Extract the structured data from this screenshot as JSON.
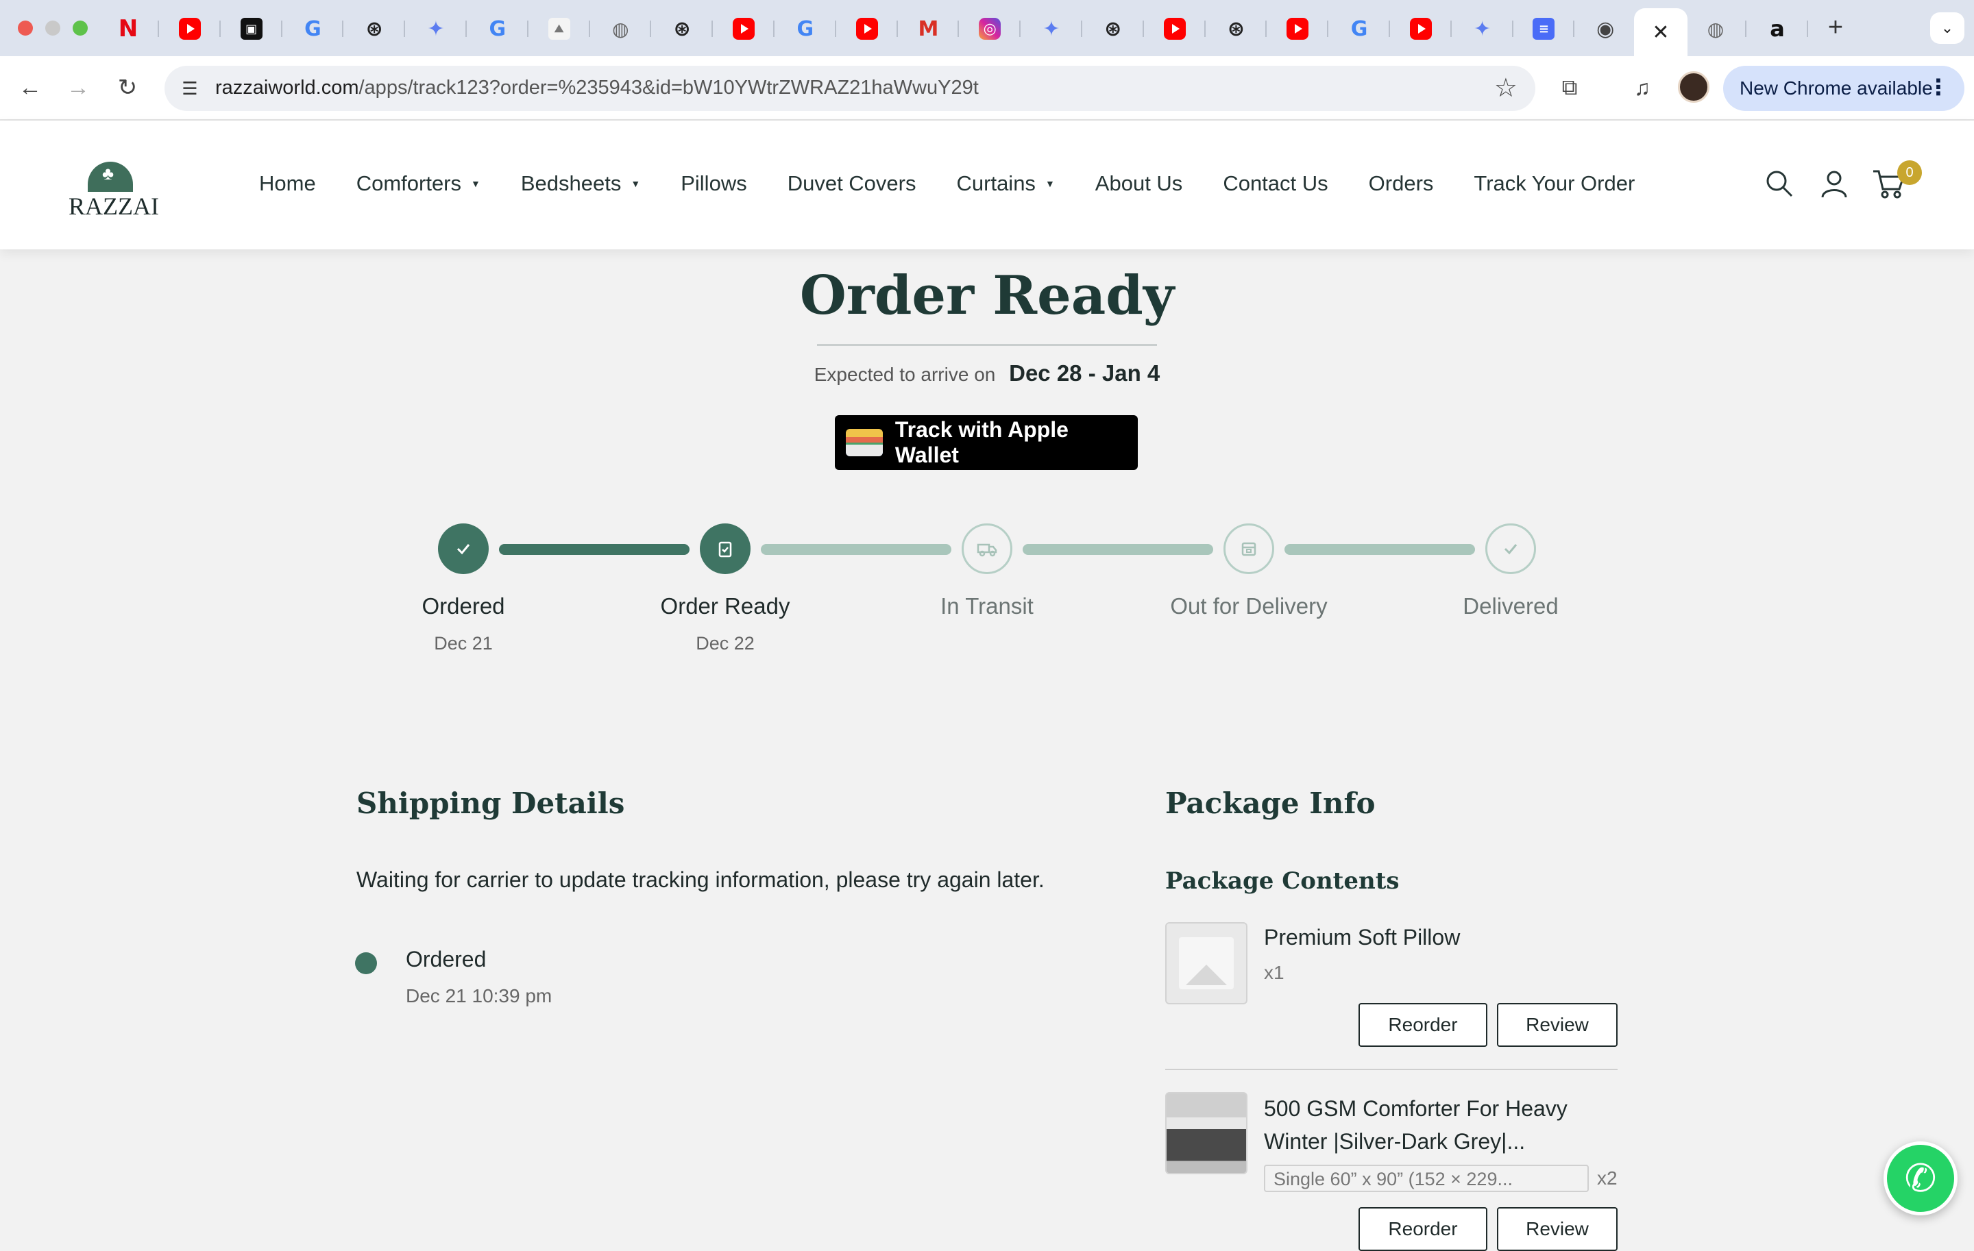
{
  "browser": {
    "tabs": [
      {
        "icon": "netflix-icon",
        "glyph": "N"
      },
      {
        "icon": "youtube-icon",
        "glyph": ""
      },
      {
        "icon": "app-icon",
        "glyph": "▣"
      },
      {
        "icon": "google-icon",
        "glyph": "G"
      },
      {
        "icon": "chatgpt-icon",
        "glyph": "⊛"
      },
      {
        "icon": "gemini-icon",
        "glyph": "✦"
      },
      {
        "icon": "google-icon",
        "glyph": "G"
      },
      {
        "icon": "image-icon",
        "glyph": "⛰"
      },
      {
        "icon": "globe-icon",
        "glyph": "◍"
      },
      {
        "icon": "chatgpt-icon",
        "glyph": "⊛"
      },
      {
        "icon": "youtube-icon",
        "glyph": ""
      },
      {
        "icon": "google-icon",
        "glyph": "G"
      },
      {
        "icon": "youtube-icon",
        "glyph": ""
      },
      {
        "icon": "gmail-icon",
        "glyph": "M"
      },
      {
        "icon": "instagram-icon",
        "glyph": "◎"
      },
      {
        "icon": "gemini-icon",
        "glyph": "✦"
      },
      {
        "icon": "chatgpt-icon",
        "glyph": "⊛"
      },
      {
        "icon": "youtube-icon",
        "glyph": ""
      },
      {
        "icon": "chatgpt-icon",
        "glyph": "⊛"
      },
      {
        "icon": "youtube-icon",
        "glyph": ""
      },
      {
        "icon": "google-icon",
        "glyph": "G"
      },
      {
        "icon": "youtube-icon",
        "glyph": ""
      },
      {
        "icon": "gemini-icon",
        "glyph": "✦"
      },
      {
        "icon": "docs-icon",
        "glyph": "≡"
      },
      {
        "icon": "chrome-icon",
        "glyph": "◉"
      }
    ],
    "active_tab_close": "✕",
    "tabs_after": [
      {
        "icon": "globe-icon",
        "glyph": "◍"
      },
      {
        "icon": "amazon-icon",
        "glyph": "a"
      }
    ],
    "new_tab": "+",
    "tab_menu": "⌄",
    "url_host": "razzaiworld.com",
    "url_path": "/apps/track123?order=%235943&id=bW10YWtrZWRAZ21haWwuY29t",
    "update_label": "New Chrome available"
  },
  "site": {
    "logo_text": "RAZZAI",
    "nav": [
      {
        "label": "Home",
        "dropdown": false
      },
      {
        "label": "Comforters",
        "dropdown": true
      },
      {
        "label": "Bedsheets",
        "dropdown": true
      },
      {
        "label": "Pillows",
        "dropdown": false
      },
      {
        "label": "Duvet Covers",
        "dropdown": false
      },
      {
        "label": "Curtains",
        "dropdown": true
      },
      {
        "label": "About Us",
        "dropdown": false
      },
      {
        "label": "Contact Us",
        "dropdown": false
      },
      {
        "label": "Orders",
        "dropdown": false
      },
      {
        "label": "Track Your Order",
        "dropdown": false
      }
    ],
    "cart_count": "0"
  },
  "order": {
    "title": "Order Ready",
    "expected_label": "Expected to arrive on",
    "expected_dates": "Dec 28 - Jan 4",
    "wallet_button": "Track with Apple Wallet",
    "steps": [
      {
        "label": "Ordered",
        "date": "Dec 21",
        "done": true,
        "icon": "check-icon"
      },
      {
        "label": "Order Ready",
        "date": "Dec 22",
        "done": true,
        "icon": "clipboard-check-icon"
      },
      {
        "label": "In Transit",
        "date": "",
        "done": false,
        "icon": "truck-icon"
      },
      {
        "label": "Out for Delivery",
        "date": "",
        "done": false,
        "icon": "package-icon"
      },
      {
        "label": "Delivered",
        "date": "",
        "done": false,
        "icon": "check-icon"
      }
    ],
    "progress_fraction": 0.25
  },
  "shipping": {
    "title": "Shipping Details",
    "message": "Waiting for carrier to update tracking information, please try again later.",
    "events": [
      {
        "status": "Ordered",
        "time": "Dec 21 10:39 pm"
      }
    ]
  },
  "package": {
    "title": "Package Info",
    "contents_title": "Package Contents",
    "items": [
      {
        "name": "Premium Soft Pillow",
        "qty": "x1",
        "variant": "",
        "reorder": "Reorder",
        "review": "Review"
      },
      {
        "name": "500 GSM Comforter For Heavy Winter |Silver-Dark Grey|...",
        "qty": "x2",
        "variant": "Single 60” x 90” (152 × 229...",
        "reorder": "Reorder",
        "review": "Review"
      }
    ]
  },
  "colors": {
    "accent": "#3f7463",
    "accent_light": "#a9c6bb",
    "heading": "#1f3a36",
    "badge": "#c8a62e"
  }
}
